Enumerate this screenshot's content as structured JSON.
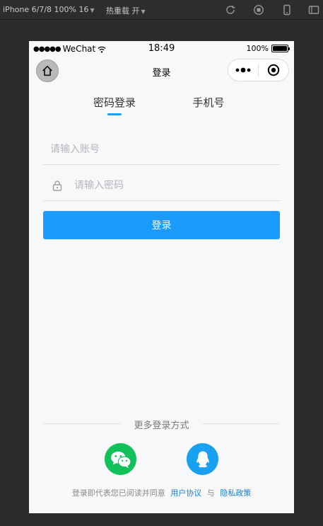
{
  "devtools": {
    "device": "iPhone 6/7/8 100% 16",
    "hot_reload": "热重载 开"
  },
  "status": {
    "carrier": "WeChat",
    "time": "18:49",
    "battery": "100%",
    "battery_level": 1.0
  },
  "nav": {
    "title": "登录"
  },
  "tabs": [
    {
      "label": "密码登录",
      "active": true
    },
    {
      "label": "手机号",
      "active": false
    }
  ],
  "form": {
    "account_placeholder": "请输入账号",
    "password_placeholder": "请输入密码",
    "login_label": "登录"
  },
  "more": {
    "title": "更多登录方式",
    "options": [
      {
        "name": "wechat",
        "color": "#13c15a"
      },
      {
        "name": "qq",
        "color": "#1aa0f0"
      }
    ]
  },
  "agreement": {
    "prefix": "登录即代表您已阅读并同意",
    "user_agreement": "用户协议",
    "conjunction": "与",
    "privacy_policy": "隐私政策"
  },
  "colors": {
    "accent": "#1c9bff",
    "link": "#1c7fd6"
  }
}
